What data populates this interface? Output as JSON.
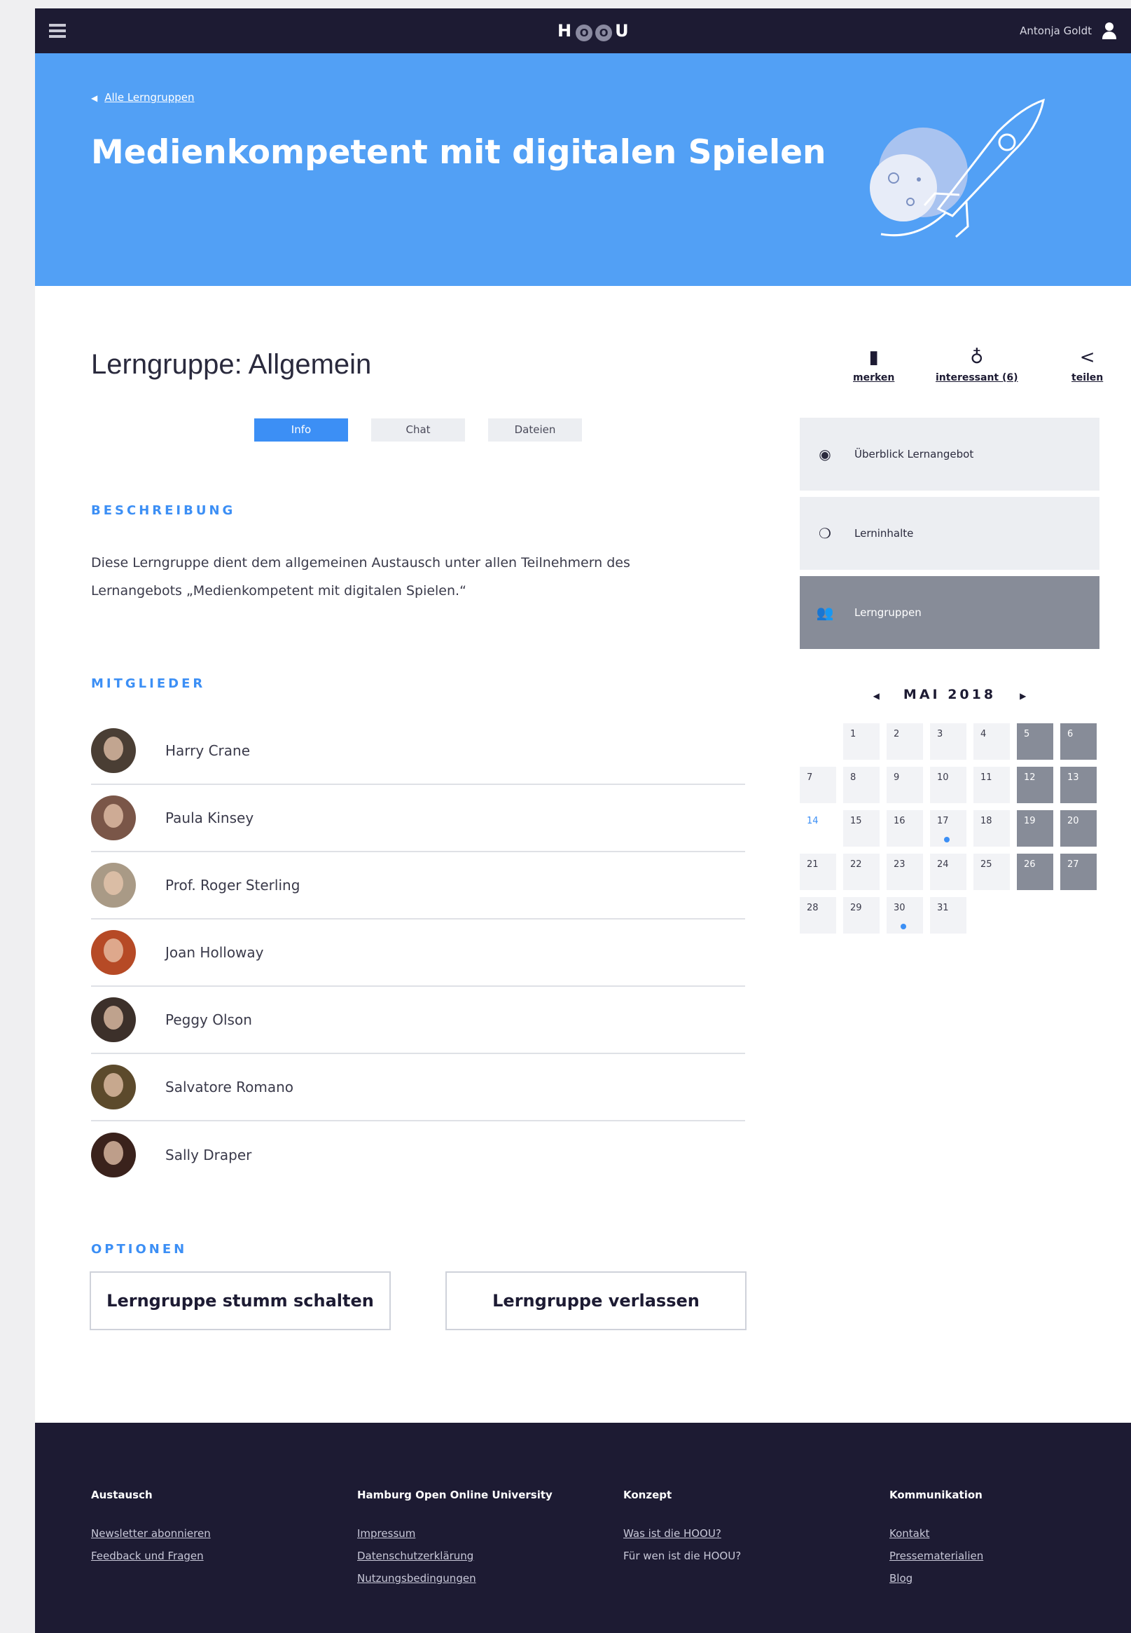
{
  "topbar": {
    "logo": "HOOU",
    "user_name": "Antonja Goldt"
  },
  "hero": {
    "back_link": "Alle Lerngruppen",
    "title": "Medienkompetent mit digitalen Spielen"
  },
  "main": {
    "heading": "Lerngruppe: Allgemein",
    "tabs": [
      {
        "label": "Info",
        "active": true
      },
      {
        "label": "Chat",
        "active": false
      },
      {
        "label": "Dateien",
        "active": false
      }
    ],
    "description_label": "BESCHREIBUNG",
    "description_line1": "Diese Lerngruppe dient dem allgemeinen Austausch unter allen Teilnehmern des",
    "description_line2": "Lernangebots „Medienkompetent mit digitalen Spielen.“",
    "members_label": "MITGLIEDER",
    "members": [
      {
        "name": "Harry Crane"
      },
      {
        "name": "Paula Kinsey"
      },
      {
        "name": "Prof. Roger Sterling"
      },
      {
        "name": "Joan Holloway"
      },
      {
        "name": "Peggy Olson"
      },
      {
        "name": "Salvatore Romano"
      },
      {
        "name": "Sally Draper"
      }
    ],
    "options_label": "OPTIONEN",
    "mute_button": "Lerngruppe stumm schalten",
    "leave_button": "Lerngruppe verlassen"
  },
  "sidebar": {
    "actions": [
      {
        "label": "merken",
        "icon": "bookmark-icon"
      },
      {
        "label": "interessant (6)",
        "icon": "lightbulb-icon"
      },
      {
        "label": "teilen",
        "icon": "share-icon"
      }
    ],
    "nav": [
      {
        "label": "Überblick Lernangebot",
        "icon": "eye-icon",
        "active": false
      },
      {
        "label": "Lerninhalte",
        "icon": "chat-bubbles-icon",
        "active": false
      },
      {
        "label": "Lerngruppen",
        "icon": "group-icon",
        "active": true
      }
    ],
    "calendar": {
      "month": "MAI 2018",
      "leading_blanks": 1,
      "days_in_month": 31,
      "weekend_days": [
        5,
        6,
        12,
        13,
        19,
        20,
        26,
        27
      ],
      "today": 14,
      "event_days": [
        17,
        30
      ]
    }
  },
  "footer": {
    "columns": [
      {
        "title": "Austausch",
        "links": [
          "Newsletter abonnieren",
          "Feedback und Fragen"
        ]
      },
      {
        "title": "Hamburg Open Online University",
        "links": [
          "Impressum",
          "Datenschutzerklärung",
          "Nutzungsbedingungen"
        ]
      },
      {
        "title": "Konzept",
        "links": [
          "Was ist die HOOU?",
          "Für wen ist die HOOU?"
        ]
      },
      {
        "title": "Kommunikation",
        "links": [
          "Kontakt",
          "Pressematerialien",
          "Blog"
        ]
      }
    ]
  },
  "colors": {
    "navy": "#1d1b33",
    "hero_blue": "#52a0f5",
    "accent_blue": "#3c8ff5",
    "nav_active_gray": "#878c98",
    "panel_gray": "#eceef2"
  }
}
